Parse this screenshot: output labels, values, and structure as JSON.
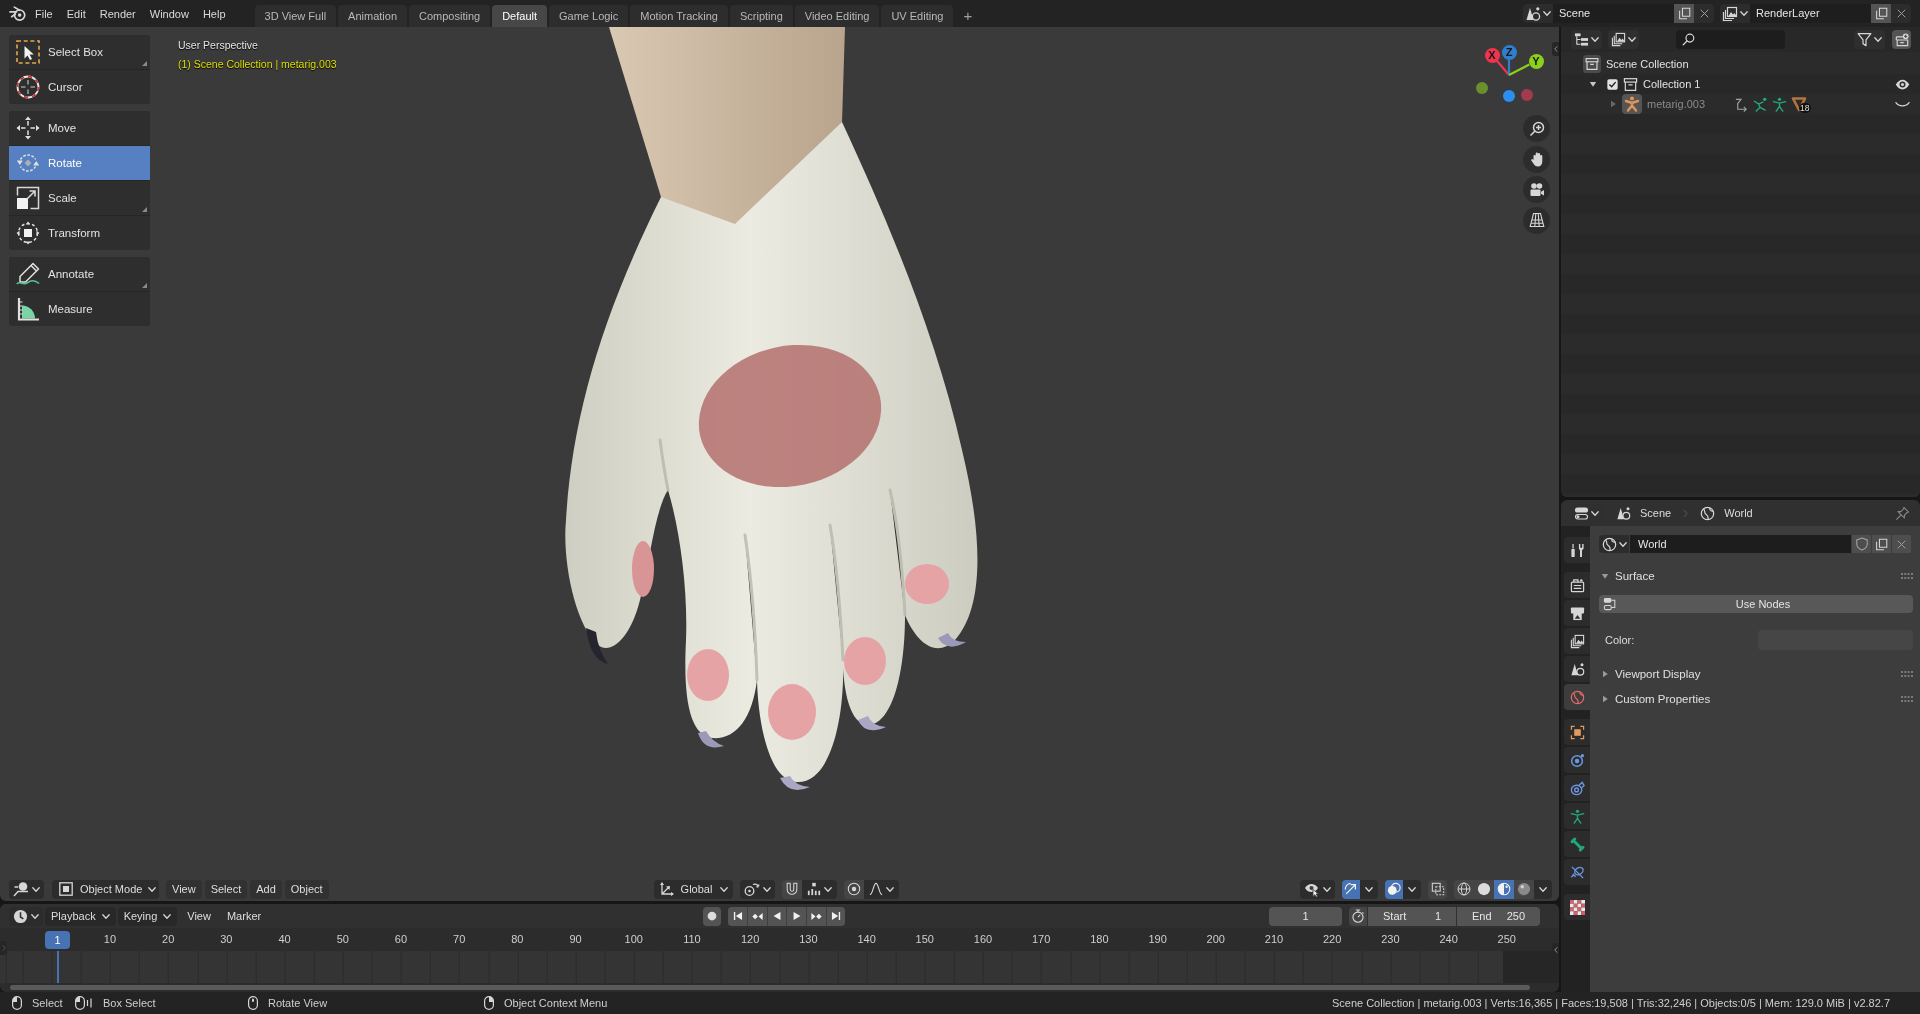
{
  "top_bar": {
    "menus": [
      "File",
      "Edit",
      "Render",
      "Window",
      "Help"
    ],
    "workspaces": [
      {
        "label": "3D View Full",
        "selected": false
      },
      {
        "label": "Animation",
        "selected": false
      },
      {
        "label": "Compositing",
        "selected": false
      },
      {
        "label": "Default",
        "selected": true
      },
      {
        "label": "Game Logic",
        "selected": false
      },
      {
        "label": "Motion Tracking",
        "selected": false
      },
      {
        "label": "Scripting",
        "selected": false
      },
      {
        "label": "Video Editing",
        "selected": false
      },
      {
        "label": "UV Editing",
        "selected": false
      }
    ],
    "add_workspace": "+",
    "scene": "Scene",
    "view_layer": "RenderLayer"
  },
  "viewport": {
    "tool_groups": [
      {
        "tools": [
          {
            "kind": "select",
            "label": "Select Box",
            "selected": false,
            "more": true
          },
          {
            "kind": "cursor",
            "label": "Cursor",
            "selected": false,
            "more": false
          }
        ]
      },
      {
        "tools": [
          {
            "kind": "move",
            "label": "Move",
            "selected": false,
            "more": false
          },
          {
            "kind": "rotate",
            "label": "Rotate",
            "selected": true,
            "more": false
          },
          {
            "kind": "scale",
            "label": "Scale",
            "selected": false,
            "more": true
          },
          {
            "kind": "transform",
            "label": "Transform",
            "selected": false,
            "more": false
          }
        ]
      },
      {
        "tools": [
          {
            "kind": "annotate",
            "label": "Annotate",
            "selected": false,
            "more": true
          },
          {
            "kind": "measure",
            "label": "Measure",
            "selected": false,
            "more": false
          }
        ]
      }
    ],
    "view_name": "User Perspective",
    "context": "(1) Scene Collection | metarig.003",
    "keyed": true,
    "gizmo_axes": [
      {
        "label": "X",
        "color": "#f0344f"
      },
      {
        "label": "Z",
        "color": "#2f7fd0"
      },
      {
        "label": "Y",
        "color": "#8bd11c"
      }
    ],
    "header": {
      "mode": "Object Mode",
      "menus": [
        "View",
        "Select",
        "Add",
        "Object"
      ],
      "orientation": "Global",
      "snap": false,
      "proportional": false,
      "gizmos": true,
      "overlays": true,
      "xray": false,
      "shading": [
        {
          "kind": "wireframe",
          "selected": false
        },
        {
          "kind": "solid",
          "selected": false
        },
        {
          "kind": "material",
          "selected": true
        },
        {
          "kind": "rendered",
          "selected": false
        }
      ]
    }
  },
  "timeline": {
    "menus": [
      {
        "label": "Playback",
        "dropdown": true
      },
      {
        "label": "Keying",
        "dropdown": true
      },
      {
        "label": "View",
        "dropdown": false
      },
      {
        "label": "Marker",
        "dropdown": false
      }
    ],
    "auto_key": false,
    "current_frame": "1",
    "start_label": "Start",
    "start": "1",
    "end_label": "End",
    "end": "250",
    "playhead": "1",
    "ruler": [
      "10",
      "20",
      "30",
      "40",
      "50",
      "60",
      "70",
      "80",
      "90",
      "100",
      "110",
      "120",
      "130",
      "140",
      "150",
      "160",
      "170",
      "180",
      "190",
      "200",
      "210",
      "220",
      "230",
      "240",
      "250"
    ]
  },
  "outliner": {
    "tree": [
      {
        "label": "Scene Collection",
        "kind": "scene",
        "children": [
          {
            "label": "Collection 1",
            "kind": "collection",
            "expanded": true,
            "checked": true,
            "visible": true,
            "children": [
              {
                "label": "metarig.003",
                "kind": "armature",
                "expanded": false,
                "visible": false,
                "count": "18"
              }
            ]
          }
        ]
      }
    ]
  },
  "properties": {
    "breadcrumbs": [
      {
        "kind": "scene",
        "label": "Scene"
      },
      {
        "kind": "world",
        "label": "World"
      }
    ],
    "tab_groups": [
      {
        "tabs": [
          {
            "kind": "tool",
            "selected": false
          }
        ]
      },
      {
        "tabs": [
          {
            "kind": "render",
            "selected": false
          },
          {
            "kind": "output",
            "selected": false
          },
          {
            "kind": "viewlayer",
            "selected": false
          },
          {
            "kind": "scene",
            "selected": false
          },
          {
            "kind": "world",
            "selected": true
          }
        ]
      },
      {
        "tabs": [
          {
            "kind": "object",
            "selected": false
          },
          {
            "kind": "physics",
            "selected": false
          },
          {
            "kind": "constraints",
            "selected": false
          },
          {
            "kind": "data",
            "selected": false
          },
          {
            "kind": "bone",
            "selected": false
          },
          {
            "kind": "boneconstraints",
            "selected": false
          }
        ]
      },
      {
        "tabs": [
          {
            "kind": "texture",
            "selected": false
          }
        ]
      }
    ],
    "datablock": "World",
    "panels": [
      {
        "title": "Surface",
        "expanded": true,
        "button": "Use Nodes",
        "field_label": "Color:"
      },
      {
        "title": "Viewport Display",
        "expanded": false
      },
      {
        "title": "Custom Properties",
        "expanded": false
      }
    ]
  },
  "status_bar": {
    "hints": [
      {
        "kind": "left",
        "label": "Select"
      },
      {
        "kind": "drag",
        "label": "Box Select"
      },
      {
        "kind": "middle",
        "label": "Rotate View"
      },
      {
        "kind": "right",
        "label": "Object Context Menu"
      }
    ],
    "stats": "Scene Collection | metarig.003 | Verts:16,365 | Faces:19,508 | Tris:32,246 | Objects:0/5 | Mem: 129.0 MiB | v2.82.7"
  }
}
